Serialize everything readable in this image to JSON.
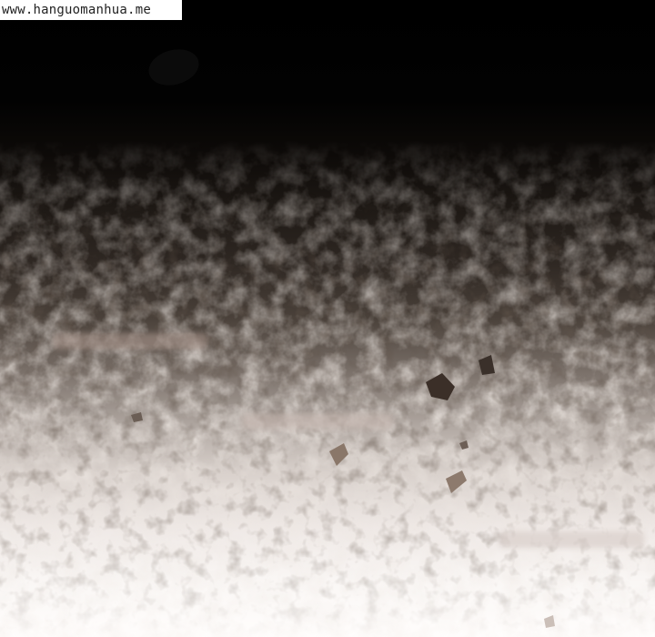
{
  "watermark": {
    "text": "www.hanguomanhua.me"
  },
  "colors": {
    "top": "#000000",
    "middle": "#4a413a",
    "bottom": "#fffdfc"
  }
}
